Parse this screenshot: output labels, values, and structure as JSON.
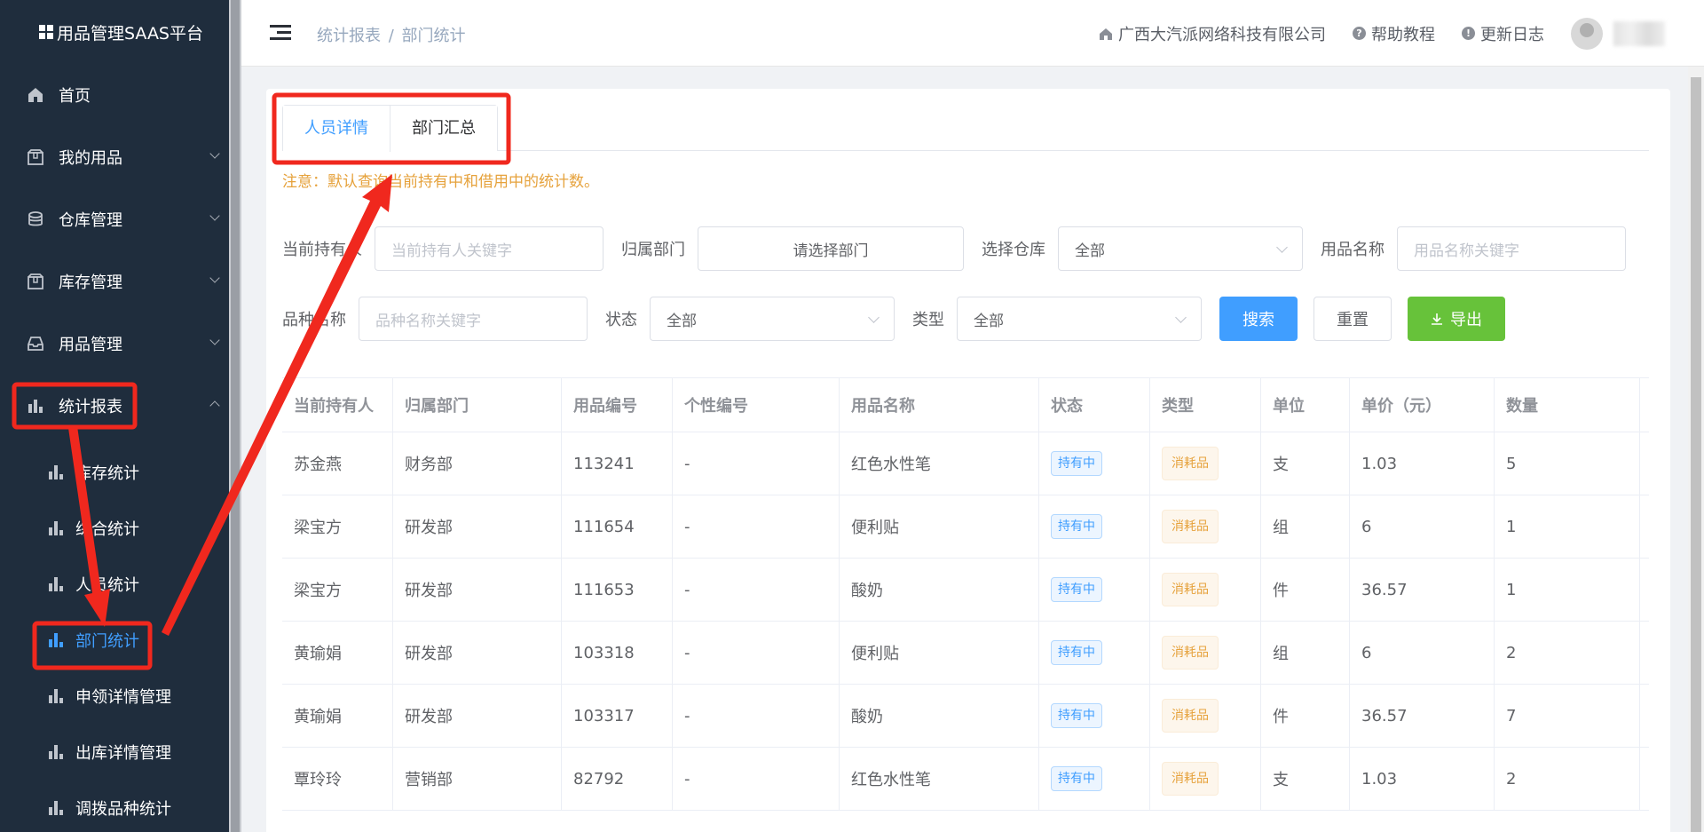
{
  "brand": {
    "title": "用品管理SAAS平台"
  },
  "sidebar": {
    "items": [
      {
        "label": "首页",
        "icon": "home-icon"
      },
      {
        "label": "我的用品",
        "icon": "box-icon"
      },
      {
        "label": "仓库管理",
        "icon": "database-icon"
      },
      {
        "label": "库存管理",
        "icon": "box-icon"
      },
      {
        "label": "用品管理",
        "icon": "inbox-icon"
      },
      {
        "label": "统计报表",
        "icon": "bar-chart-icon"
      }
    ],
    "sub_items": [
      {
        "label": "库存统计"
      },
      {
        "label": "综合统计"
      },
      {
        "label": "人员统计"
      },
      {
        "label": "部门统计"
      },
      {
        "label": "申领详情管理"
      },
      {
        "label": "出库详情管理"
      },
      {
        "label": "调拨品种统计"
      }
    ]
  },
  "header": {
    "breadcrumb_parent": "统计报表",
    "breadcrumb_sep": "/",
    "breadcrumb_current": "部门统计",
    "company": "广西大汽派网络科技有限公司",
    "help": "帮助教程",
    "changelog": "更新日志"
  },
  "tabs": [
    {
      "label": "人员详情"
    },
    {
      "label": "部门汇总"
    }
  ],
  "notice": "注意：默认查询当前持有中和借用中的统计数。",
  "filters": {
    "holder_label": "当前持有人",
    "holder_placeholder": "当前持有人关键字",
    "dept_label": "归属部门",
    "dept_value": "请选择部门",
    "warehouse_label": "选择仓库",
    "warehouse_value": "全部",
    "item_name_label": "用品名称",
    "item_name_placeholder": "用品名称关键字",
    "variety_label": "品种名称",
    "variety_placeholder": "品种名称关键字",
    "status_label": "状态",
    "status_value": "全部",
    "type_label": "类型",
    "type_value": "全部",
    "search_btn": "搜索",
    "reset_btn": "重置",
    "export_btn": "导出"
  },
  "table": {
    "columns": [
      "当前持有人",
      "归属部门",
      "用品编号",
      "个性编号",
      "用品名称",
      "状态",
      "类型",
      "单位",
      "单价（元）",
      "数量"
    ],
    "rows": [
      [
        "苏金燕",
        "财务部",
        "113241",
        "-",
        "红色水性笔",
        "持有中",
        "消耗品",
        "支",
        "1.03",
        "5"
      ],
      [
        "梁宝方",
        "研发部",
        "111654",
        "-",
        "便利贴",
        "持有中",
        "消耗品",
        "组",
        "6",
        "1"
      ],
      [
        "梁宝方",
        "研发部",
        "111653",
        "-",
        "酸奶",
        "持有中",
        "消耗品",
        "件",
        "36.57",
        "1"
      ],
      [
        "黄瑜娟",
        "研发部",
        "103318",
        "-",
        "便利贴",
        "持有中",
        "消耗品",
        "组",
        "6",
        "2"
      ],
      [
        "黄瑜娟",
        "研发部",
        "103317",
        "-",
        "酸奶",
        "持有中",
        "消耗品",
        "件",
        "36.57",
        "7"
      ],
      [
        "覃玲玲",
        "营销部",
        "82792",
        "-",
        "红色水性笔",
        "持有中",
        "消耗品",
        "支",
        "1.03",
        "2"
      ]
    ]
  },
  "colors": {
    "primary": "#409eff",
    "sidebar_bg": "#1f2d3d",
    "annotation": "#f0281e",
    "success": "#67c23a",
    "warning": "#e6a23c"
  }
}
